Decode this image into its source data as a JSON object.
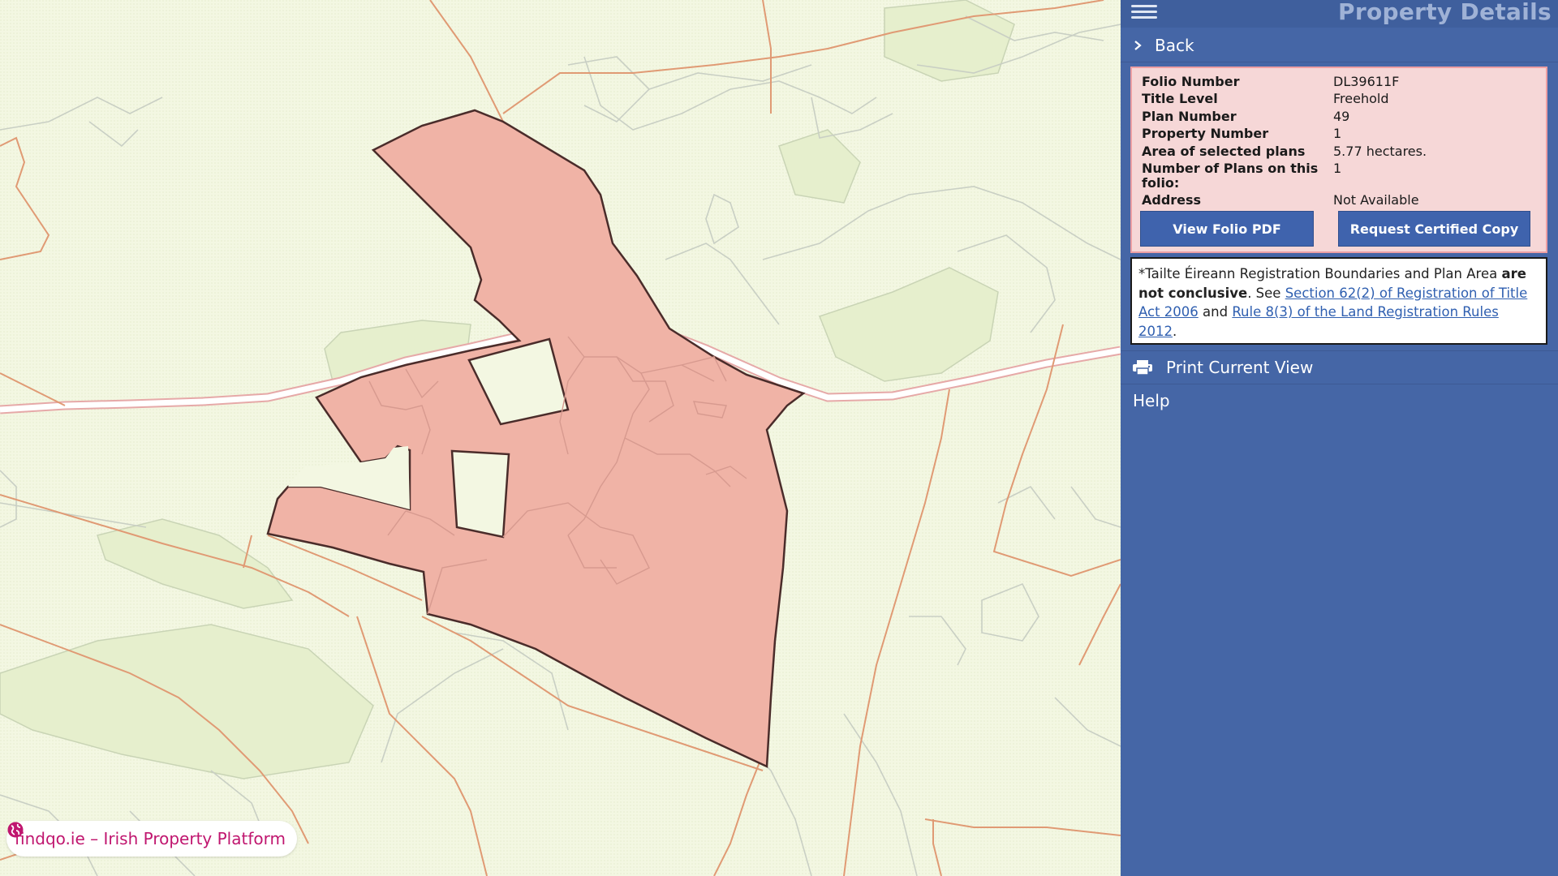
{
  "panel": {
    "title": "Property Details",
    "back_label": "Back",
    "print_label": "Print Current View",
    "help_label": "Help"
  },
  "details": {
    "rows": [
      {
        "key": "Folio Number",
        "value": "DL39611F"
      },
      {
        "key": "Title Level",
        "value": "Freehold"
      },
      {
        "key": "Plan Number",
        "value": "49"
      },
      {
        "key": "Property Number",
        "value": "1"
      },
      {
        "key": "Area of selected plans",
        "value": "5.77 hectares."
      },
      {
        "key": "Number of Plans on this folio:",
        "value": "1"
      },
      {
        "key": "Address",
        "value": "Not Available"
      }
    ],
    "view_pdf_label": "View Folio PDF",
    "request_copy_label": "Request Certified Copy"
  },
  "disclaimer": {
    "prefix": "*Tailte Éireann Registration Boundaries and Plan Area ",
    "bold": "are not conclusive",
    "middle": ". See ",
    "link1": "Section 62(2) of Registration of Title Act 2006",
    "and": " and ",
    "link2": "Rule 8(3) of the Land Registration Rules 2012",
    "suffix": "."
  },
  "badge": {
    "text": "findqo.ie – Irish Property Platform"
  },
  "colors": {
    "panel_bg": "#4566a6",
    "parcel_fill": "#f0b3a6",
    "map_bg": "#f3f7e2",
    "button_bg": "#3f63ad",
    "badge_text": "#c0166f"
  },
  "icons": [
    "hamburger-icon",
    "chevron-right-icon",
    "printer-icon",
    "globe-icon"
  ]
}
